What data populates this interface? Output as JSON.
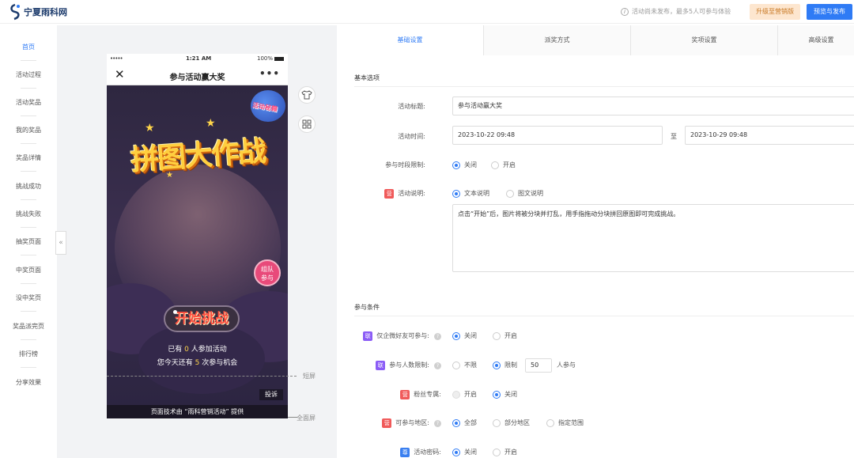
{
  "header": {
    "logo_text": "宁夏雨科网",
    "notice": "活动尚未发布，最多5人可参与体验",
    "upgrade_label": "升级至营销版",
    "publish_label": "预览与发布"
  },
  "leftnav": {
    "items": [
      {
        "label": "首页",
        "active": true
      },
      {
        "label": "活动过程"
      },
      {
        "label": "活动奖品"
      },
      {
        "label": "我的奖品"
      },
      {
        "label": "奖品详情"
      },
      {
        "label": "挑战成功"
      },
      {
        "label": "挑战失败"
      },
      {
        "label": "抽奖页面"
      },
      {
        "label": "中奖页面"
      },
      {
        "label": "没中奖页"
      },
      {
        "label": "奖品派完页"
      },
      {
        "label": "排行榜"
      },
      {
        "label": "分享效果"
      }
    ],
    "collapse_icon": "«"
  },
  "phone": {
    "status_dots": "•••••",
    "time": "1:21 AM",
    "battery": "100%",
    "close_icon": "✕",
    "title": "参与活动赢大奖",
    "more_icon": "•••",
    "title_art": "拼图大作战",
    "badge_text": "活动秘籍",
    "team_line1": "组队",
    "team_line2": "参与",
    "start_label": "开始挑战",
    "join_prefix": "已有 ",
    "join_count": "0",
    "join_suffix": " 人参加活动",
    "chance_prefix": "您今天还有 ",
    "chance_count": "5",
    "chance_suffix": " 次参与机会",
    "report_label": "投诉",
    "footer_text": "页面技术由 “雨科营销活动” 提供"
  },
  "preview": {
    "short_label": "短屏",
    "full_label": "全面屏"
  },
  "tabs": [
    {
      "label": "基础设置",
      "active": true
    },
    {
      "label": "派奖方式"
    },
    {
      "label": "奖项设置"
    },
    {
      "label": "高级设置"
    }
  ],
  "basic": {
    "section_title": "基本选项",
    "title_label": "活动标题:",
    "title_value": "参与活动赢大奖",
    "time_label": "活动时间:",
    "start_time": "2023-10-22 09:48",
    "time_sep": "至",
    "end_time": "2023-10-29 09:48",
    "period_label": "参与时段限制:",
    "period_off": "关闭",
    "period_on": "开启",
    "desc_tag": "营",
    "desc_label": "活动说明:",
    "desc_text_opt": "文本说明",
    "desc_image_opt": "图文说明",
    "desc_value": "点击“开始”后，图片将被分块并打乱，用手指拖动分块拼回原图即可完成挑战。"
  },
  "conditions": {
    "section_title": "参与条件",
    "wecom_tag": "联",
    "wecom_label": "仅企微好友可参与:",
    "wecom_off": "关闭",
    "wecom_on": "开启",
    "limit_tag": "联",
    "limit_label": "参与人数限制:",
    "limit_none": "不限",
    "limit_on": "限制",
    "limit_value": "50",
    "limit_unit": "人参与",
    "fans_tag": "营",
    "fans_label": "粉丝专属:",
    "fans_on": "开启",
    "fans_off": "关闭",
    "region_tag": "营",
    "region_label": "可参与地区:",
    "region_all": "全部",
    "region_part": "部分地区",
    "region_custom": "指定范围",
    "pwd_tag": "尊",
    "pwd_label": "活动密码:",
    "pwd_off": "关闭",
    "pwd_on": "开启"
  },
  "colors": {
    "accent": "#2f7bf5",
    "upgrade_bg": "#fde6cf"
  }
}
